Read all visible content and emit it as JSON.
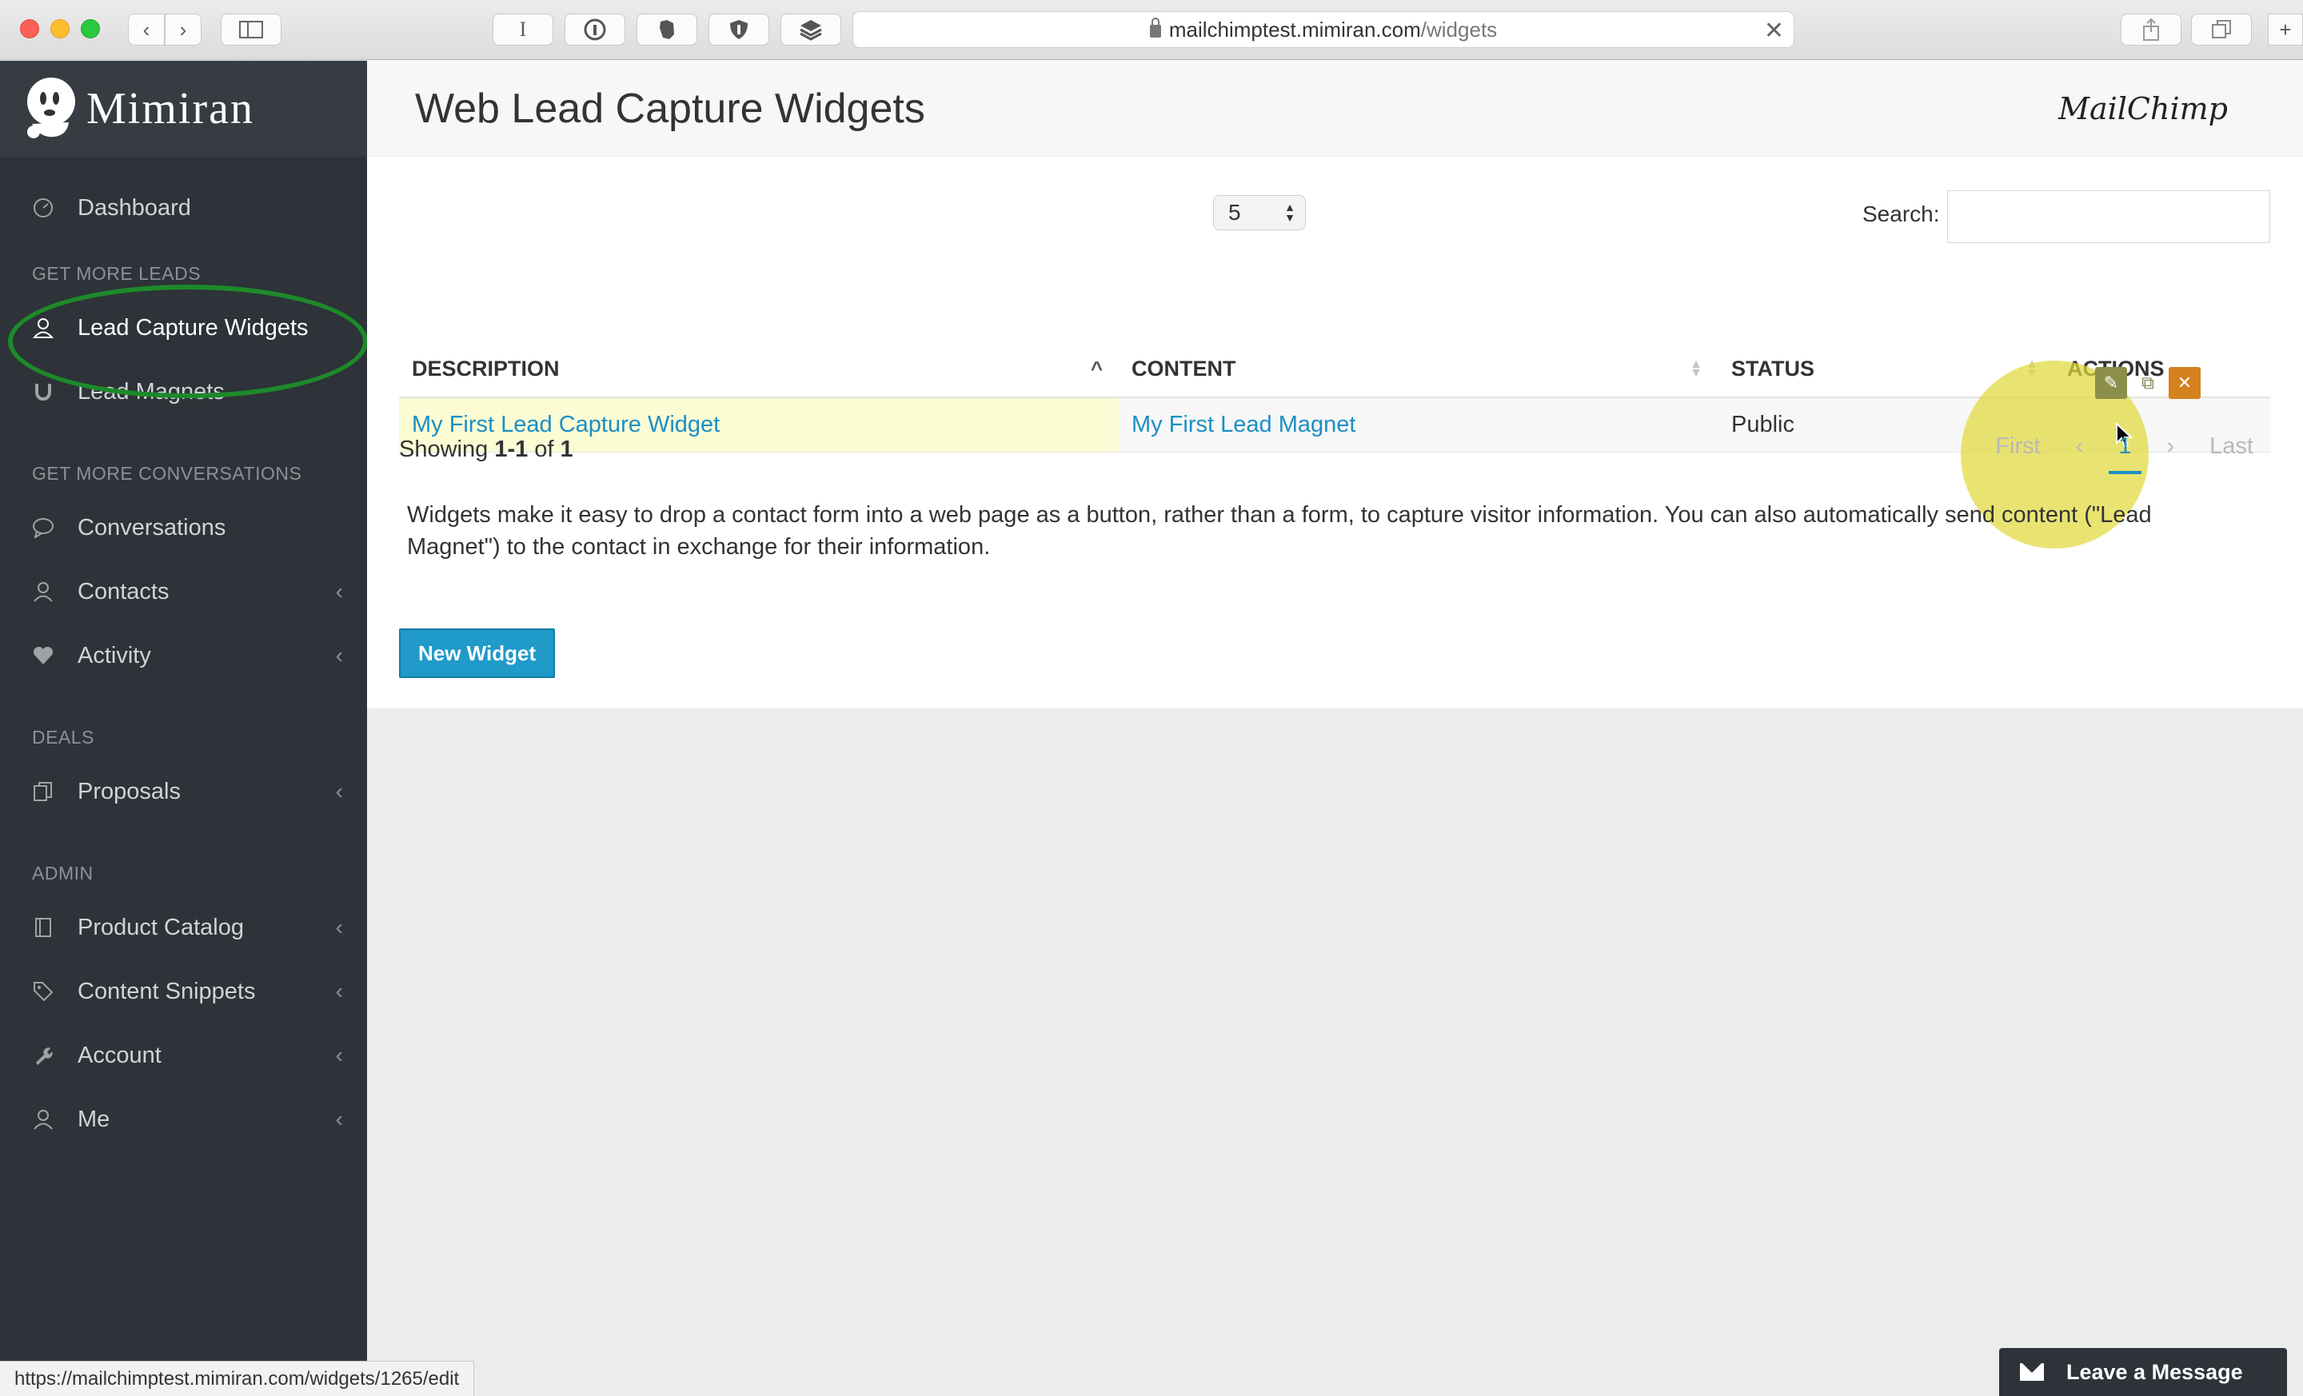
{
  "browser": {
    "url_host": "mailchimptest.mimiran.com",
    "url_path": "/widgets",
    "reader_icon": "I",
    "toolbar_icons": [
      "sidebar-icon",
      "reader-icon",
      "info-icon",
      "evernote-icon",
      "ublock-icon",
      "layers-icon",
      "share-icon",
      "tabs-icon",
      "new-tab-icon"
    ]
  },
  "sidebar": {
    "logo": "Mimiran",
    "items": [
      {
        "label": "Dashboard",
        "icon": "dashboard-icon"
      },
      {
        "section": "GET MORE LEADS"
      },
      {
        "label": "Lead Capture Widgets",
        "icon": "person-icon",
        "active": true
      },
      {
        "label": "Lead Magnets",
        "icon": "magnet-icon"
      },
      {
        "section": "GET MORE CONVERSATIONS"
      },
      {
        "label": "Conversations",
        "icon": "chat-icon"
      },
      {
        "label": "Contacts",
        "icon": "contact-icon",
        "chevron": true
      },
      {
        "label": "Activity",
        "icon": "heartbeat-icon",
        "chevron": true
      },
      {
        "section": "DEALS"
      },
      {
        "label": "Proposals",
        "icon": "documents-icon",
        "chevron": true
      },
      {
        "section": "ADMIN"
      },
      {
        "label": "Product Catalog",
        "icon": "book-icon",
        "chevron": true
      },
      {
        "label": "Content Snippets",
        "icon": "tag-icon",
        "chevron": true
      },
      {
        "label": "Account",
        "icon": "wrench-icon",
        "chevron": true
      },
      {
        "label": "Me",
        "icon": "user-icon",
        "chevron": true
      }
    ]
  },
  "page": {
    "title": "Web Lead Capture Widgets",
    "brand": "MailChimp",
    "page_size": "5",
    "search_label": "Search:",
    "search_value": "",
    "columns": [
      "DESCRIPTION",
      "CONTENT",
      "STATUS",
      "ACTIONS"
    ],
    "rows": [
      {
        "description": "My First Lead Capture Widget",
        "content": "My First Lead Magnet",
        "status": "Public"
      }
    ],
    "showing_prefix": "Showing",
    "showing_range": "1-1",
    "showing_of": "of",
    "showing_total": "1",
    "pager": {
      "first": "First",
      "prev": "‹",
      "current": "1",
      "next": "›",
      "last": "Last"
    },
    "description": "Widgets make it easy to drop a contact form into a web page as a button, rather than a form, to capture visitor information. You can also automatically send content (\"Lead Magnet\") to the contact in exchange for their information.",
    "new_button": "New Widget"
  },
  "status_bar_url": "https://mailchimptest.mimiran.com/widgets/1265/edit",
  "chat": {
    "label": "Leave a Message"
  },
  "colors": {
    "sidebar": "#2d3338",
    "link": "#1a8fc6",
    "button": "#1f9ac9",
    "delete": "#d3821e",
    "annotation_ring": "#1d8a2a",
    "highlight": "#e0da3c"
  }
}
